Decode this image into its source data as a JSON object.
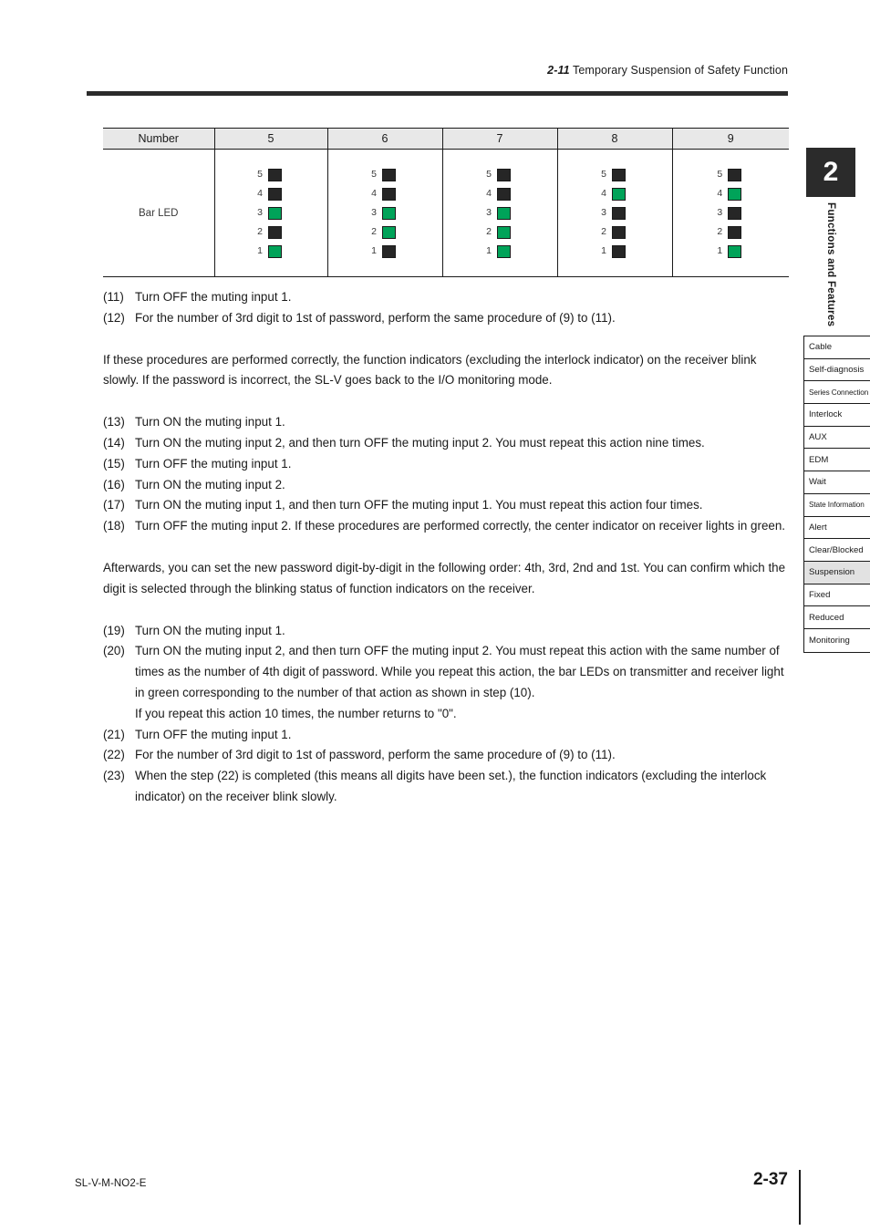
{
  "header": {
    "section_number": "2-11",
    "section_title": "Temporary Suspension of Safety Function"
  },
  "table": {
    "row_label_header": "Number",
    "row_label": "Bar LED",
    "columns": [
      "5",
      "6",
      "7",
      "8",
      "9"
    ],
    "led_labels": [
      "5",
      "4",
      "3",
      "2",
      "1"
    ],
    "colors": {
      "on": "#00a359",
      "off": "#262626"
    },
    "patterns": [
      {
        "column": "5",
        "leds": [
          {
            "index": "5",
            "state": "off"
          },
          {
            "index": "4",
            "state": "off"
          },
          {
            "index": "3",
            "state": "on"
          },
          {
            "index": "2",
            "state": "off"
          },
          {
            "index": "1",
            "state": "on"
          }
        ]
      },
      {
        "column": "6",
        "leds": [
          {
            "index": "5",
            "state": "off"
          },
          {
            "index": "4",
            "state": "off"
          },
          {
            "index": "3",
            "state": "on"
          },
          {
            "index": "2",
            "state": "on"
          },
          {
            "index": "1",
            "state": "off"
          }
        ]
      },
      {
        "column": "7",
        "leds": [
          {
            "index": "5",
            "state": "off"
          },
          {
            "index": "4",
            "state": "off"
          },
          {
            "index": "3",
            "state": "on"
          },
          {
            "index": "2",
            "state": "on"
          },
          {
            "index": "1",
            "state": "on"
          }
        ]
      },
      {
        "column": "8",
        "leds": [
          {
            "index": "5",
            "state": "off"
          },
          {
            "index": "4",
            "state": "on"
          },
          {
            "index": "3",
            "state": "off"
          },
          {
            "index": "2",
            "state": "off"
          },
          {
            "index": "1",
            "state": "off"
          }
        ]
      },
      {
        "column": "9",
        "leds": [
          {
            "index": "5",
            "state": "off"
          },
          {
            "index": "4",
            "state": "on"
          },
          {
            "index": "3",
            "state": "off"
          },
          {
            "index": "2",
            "state": "off"
          },
          {
            "index": "1",
            "state": "on"
          }
        ]
      }
    ]
  },
  "steps_group_1": [
    {
      "marker": "(11)",
      "text": "Turn OFF the muting input 1."
    },
    {
      "marker": "(12)",
      "text": "For the number of 3rd digit to 1st of password, perform the same procedure of (9) to (11)."
    }
  ],
  "paragraph_1": "If these procedures are performed correctly, the function indicators (excluding the interlock indicator) on the receiver blink slowly. If the password is incorrect, the SL-V goes back to the I/O monitoring mode.",
  "steps_group_2": [
    {
      "marker": "(13)",
      "text": "Turn ON the muting input 1."
    },
    {
      "marker": "(14)",
      "text": "Turn ON the muting input 2, and then turn OFF the muting input 2. You must repeat this action nine times."
    },
    {
      "marker": "(15)",
      "text": "Turn OFF the muting input 1."
    },
    {
      "marker": "(16)",
      "text": "Turn ON the muting input 2."
    },
    {
      "marker": "(17)",
      "text": "Turn ON the muting input 1, and then turn OFF the muting input 1. You must repeat this action four times."
    },
    {
      "marker": "(18)",
      "text": "Turn OFF the muting input 2. If these procedures are performed correctly, the center indicator on receiver lights in green."
    }
  ],
  "paragraph_2": "Afterwards, you can set the new password digit-by-digit in the following order: 4th, 3rd, 2nd and 1st. You can confirm which the digit is selected through the blinking status of function indicators on the receiver.",
  "steps_group_3": [
    {
      "marker": "(19)",
      "text": "Turn ON the muting input 1."
    },
    {
      "marker": "(20)",
      "text": "Turn ON the muting input 2, and then turn OFF the muting input 2. You must repeat this action with the same number of times as the number of 4th digit of password. While you repeat this action, the bar LEDs on transmitter and receiver light in green corresponding to the number of that action as shown in step (10)."
    },
    {
      "marker": "",
      "text": "If you repeat this action 10 times, the number returns to \"0\"."
    },
    {
      "marker": "(21)",
      "text": "Turn OFF the muting input 1."
    },
    {
      "marker": "(22)",
      "text": "For the number of 3rd digit to 1st of password, perform the same procedure of (9) to (11)."
    },
    {
      "marker": "(23)",
      "text": "When the step (22) is completed (this means all digits have been set.), the function indicators (excluding the interlock indicator) on the receiver blink slowly."
    }
  ],
  "side_tab": {
    "chapter_number": "2",
    "chapter_title": "Functions and Features",
    "index_items": [
      {
        "label": "Cable",
        "active": false,
        "tight": false
      },
      {
        "label": "Self-diagnosis",
        "active": false,
        "tight": false
      },
      {
        "label": "Series Connection",
        "active": false,
        "tight": true
      },
      {
        "label": "Interlock",
        "active": false,
        "tight": false
      },
      {
        "label": "AUX",
        "active": false,
        "tight": false
      },
      {
        "label": "EDM",
        "active": false,
        "tight": false
      },
      {
        "label": "Wait",
        "active": false,
        "tight": false
      },
      {
        "label": "State Information",
        "active": false,
        "tight": true
      },
      {
        "label": "Alert",
        "active": false,
        "tight": false
      },
      {
        "label": "Clear/Blocked",
        "active": false,
        "tight": false
      },
      {
        "label": "Suspension",
        "active": true,
        "tight": false
      },
      {
        "label": "Fixed",
        "active": false,
        "tight": false
      },
      {
        "label": "Reduced",
        "active": false,
        "tight": false
      },
      {
        "label": "Monitoring",
        "active": false,
        "tight": false
      }
    ]
  },
  "footer": {
    "document_code": "SL-V-M-NO2-E",
    "page_number": "2-37"
  }
}
